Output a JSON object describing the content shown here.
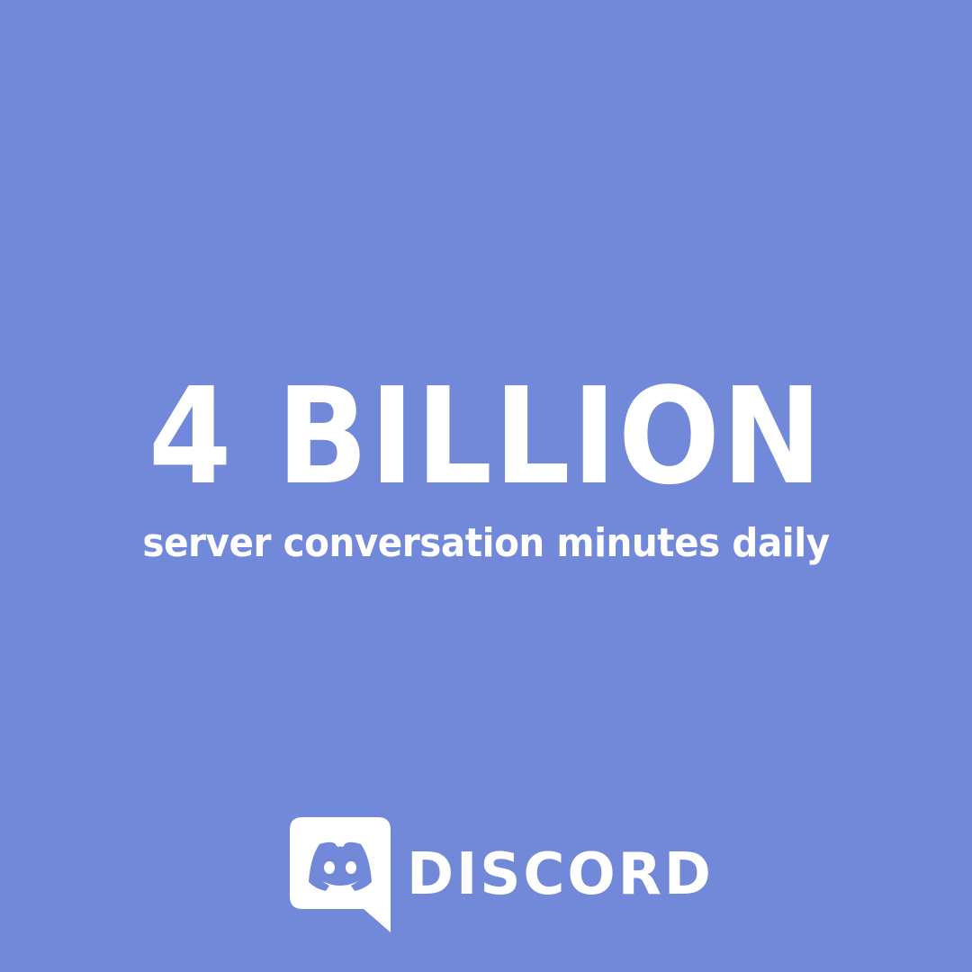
{
  "colors": {
    "background": "#7289DA",
    "foreground": "#FFFFFF"
  },
  "stat": {
    "number": "4 BILLION",
    "caption": "server conversation minutes daily"
  },
  "brand": {
    "logo_icon": "discord-logo-icon",
    "wordmark": "DISCORD"
  }
}
